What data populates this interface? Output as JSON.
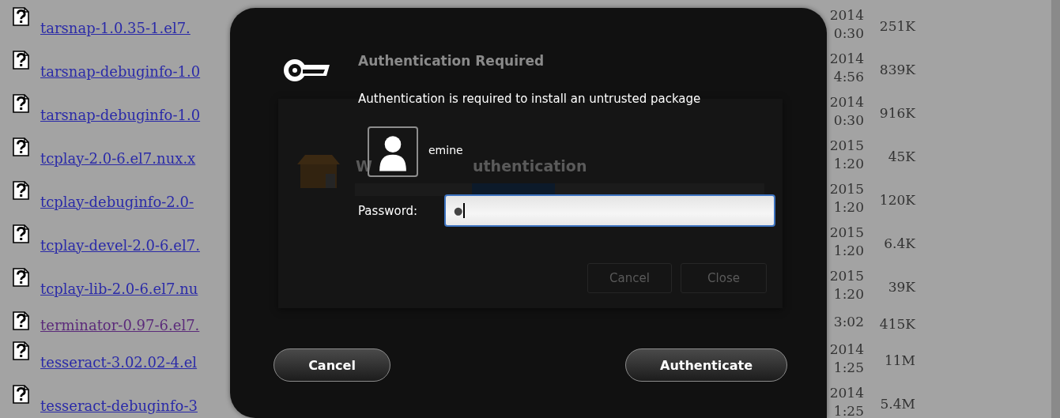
{
  "file_list": {
    "rows": [
      {
        "name": "tarsnap-1.0.35-1.el7.",
        "visited": false,
        "date": "2014",
        "time": "0:30",
        "size": "251K"
      },
      {
        "name": "tarsnap-debuginfo-1.0",
        "visited": false,
        "date": "2014",
        "time": "4:56",
        "size": "839K"
      },
      {
        "name": "tarsnap-debuginfo-1.0",
        "visited": false,
        "date": "2014",
        "time": "0:30",
        "size": "916K"
      },
      {
        "name": "tcplay-2.0-6.el7.nux.x",
        "visited": false,
        "date": "2015",
        "time": "1:20",
        "size": "45K"
      },
      {
        "name": "tcplay-debuginfo-2.0-",
        "visited": false,
        "date": "2015",
        "time": "1:20",
        "size": "120K"
      },
      {
        "name": "tcplay-devel-2.0-6.el7.",
        "visited": false,
        "date": "2015",
        "time": "1:20",
        "size": "6.4K"
      },
      {
        "name": "tcplay-lib-2.0-6.el7.nu",
        "visited": false,
        "date": "2015",
        "time": "1:20",
        "size": "39K"
      },
      {
        "name": "terminator-0.97-6.el7.",
        "visited": true,
        "time": "3:02",
        "size": "415K"
      },
      {
        "name": "tesseract-3.02.02-4.el",
        "visited": false,
        "date": "2014",
        "time": "1:25",
        "size": "11M"
      },
      {
        "name": "tesseract-debuginfo-3",
        "visited": false,
        "date": "2014",
        "time": "1:25",
        "size": "5.4M"
      }
    ]
  },
  "background_window": {
    "title_fragments": [
      "W",
      "uthentication"
    ],
    "buttons": [
      "Cancel",
      "Close"
    ]
  },
  "dialog": {
    "title": "Authentication Required",
    "message": "Authentication is required to install an untrusted package",
    "user": "emine",
    "password_label": "Password:",
    "password_value": "●",
    "buttons": [
      {
        "label": "Cancel",
        "kind": "cancel"
      },
      {
        "label": "Authenticate",
        "kind": "default"
      }
    ]
  }
}
